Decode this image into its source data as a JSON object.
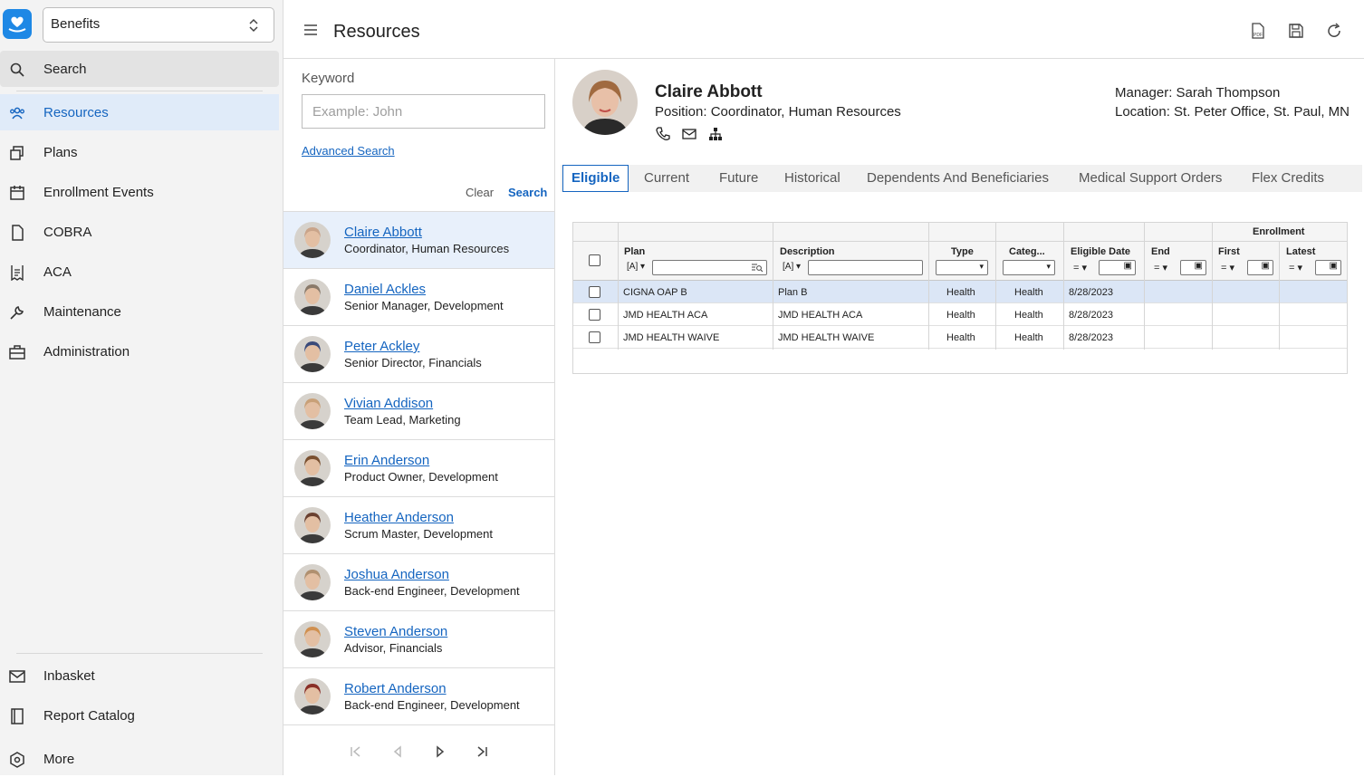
{
  "app": {
    "module_select": "Benefits"
  },
  "nav": {
    "search": "Search",
    "items": [
      {
        "label": "Resources",
        "icon": "people-icon"
      },
      {
        "label": "Plans",
        "icon": "copy-icon"
      },
      {
        "label": "Enrollment Events",
        "icon": "calendar-icon"
      },
      {
        "label": "COBRA",
        "icon": "document-icon"
      },
      {
        "label": "ACA",
        "icon": "receipt-icon"
      },
      {
        "label": "Maintenance",
        "icon": "wrench-icon"
      },
      {
        "label": "Administration",
        "icon": "briefcase-icon"
      }
    ],
    "bottom": [
      {
        "label": "Inbasket",
        "icon": "mail-icon"
      },
      {
        "label": "Report Catalog",
        "icon": "book-icon"
      },
      {
        "label": "More",
        "icon": "more-icon"
      }
    ]
  },
  "header": {
    "title": "Resources"
  },
  "search_panel": {
    "keyword_label": "Keyword",
    "keyword_placeholder": "Example: John",
    "keyword_value": "",
    "advanced": "Advanced Search",
    "clear": "Clear",
    "search": "Search"
  },
  "people": [
    {
      "name": "Claire Abbott",
      "position": "Coordinator, Human Resources",
      "color": "#c9a48a"
    },
    {
      "name": "Daniel Ackles",
      "position": "Senior Manager, Development",
      "color": "#8a7a6a"
    },
    {
      "name": "Peter Ackley",
      "position": "Senior Director, Financials",
      "color": "#3a4a7a"
    },
    {
      "name": "Vivian Addison",
      "position": "Team Lead, Marketing",
      "color": "#c8a078"
    },
    {
      "name": "Erin Anderson",
      "position": "Product Owner, Development",
      "color": "#7a5030"
    },
    {
      "name": "Heather Anderson",
      "position": "Scrum Master, Development",
      "color": "#6a4030"
    },
    {
      "name": "Joshua Anderson",
      "position": "Back-end Engineer, Development",
      "color": "#b09070"
    },
    {
      "name": "Steven Anderson",
      "position": "Advisor, Financials",
      "color": "#d09050"
    },
    {
      "name": "Robert Anderson",
      "position": "Back-end Engineer, Development",
      "color": "#8a3028"
    }
  ],
  "profile": {
    "name": "Claire Abbott",
    "position": "Position: Coordinator, Human Resources",
    "manager": "Manager: Sarah Thompson",
    "location": "Location: St. Peter Office, St. Paul, MN"
  },
  "tabs": [
    "Eligible",
    "Current",
    "Future",
    "Historical",
    "Dependents And Beneficiaries",
    "Medical Support Orders",
    "Flex Credits"
  ],
  "grid": {
    "group_header": "Enrollment",
    "columns": [
      "Plan",
      "Description",
      "Type",
      "Categ...",
      "Eligible Date",
      "End",
      "First",
      "Latest"
    ],
    "filter_op_text": "[A]",
    "filter_op_eq": "=",
    "rows": [
      {
        "plan": "CIGNA OAP B",
        "description": "Plan B",
        "type": "Health",
        "category": "Health",
        "eligible_date": "8/28/2023",
        "end": "",
        "first": "",
        "latest": ""
      },
      {
        "plan": "JMD HEALTH ACA",
        "description": "JMD HEALTH ACA",
        "type": "Health",
        "category": "Health",
        "eligible_date": "8/28/2023",
        "end": "",
        "first": "",
        "latest": ""
      },
      {
        "plan": "JMD HEALTH WAIVE",
        "description": "JMD HEALTH WAIVE",
        "type": "Health",
        "category": "Health",
        "eligible_date": "8/28/2023",
        "end": "",
        "first": "",
        "latest": ""
      }
    ]
  }
}
